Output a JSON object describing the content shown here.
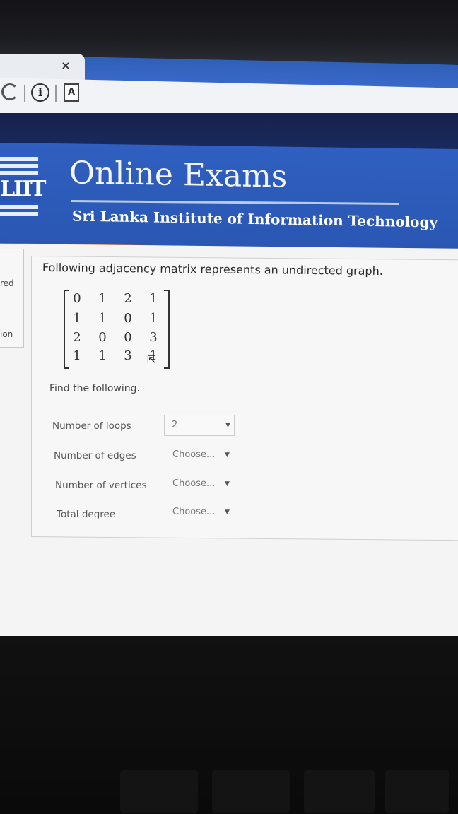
{
  "browser": {
    "tab_close": "×",
    "info_icon": "i",
    "page_icon": "A"
  },
  "header": {
    "logo_text": "LIIT",
    "title": "Online Exams",
    "subtitle": "Sri Lanka Institute of Information Technology"
  },
  "left_panel": {
    "label_1": "red",
    "label_2": "ion"
  },
  "question": {
    "text": "Following adjacency matrix represents an undirected graph.",
    "matrix": [
      [
        "0",
        "1",
        "2",
        "1"
      ],
      [
        "1",
        "1",
        "0",
        "1"
      ],
      [
        "2",
        "0",
        "0",
        "3"
      ],
      [
        "1",
        "1",
        "3",
        "1"
      ]
    ],
    "instruction": "Find the following.",
    "items": [
      {
        "label": "Number of loops",
        "value": "2"
      },
      {
        "label": "Number of edges",
        "value": "Choose..."
      },
      {
        "label": "Number of vertices",
        "value": "Choose..."
      },
      {
        "label": "Total degree",
        "value": "Choose..."
      }
    ]
  },
  "colors": {
    "banner": "#2f5fc0",
    "accent_stripe": "#d86a2c"
  }
}
